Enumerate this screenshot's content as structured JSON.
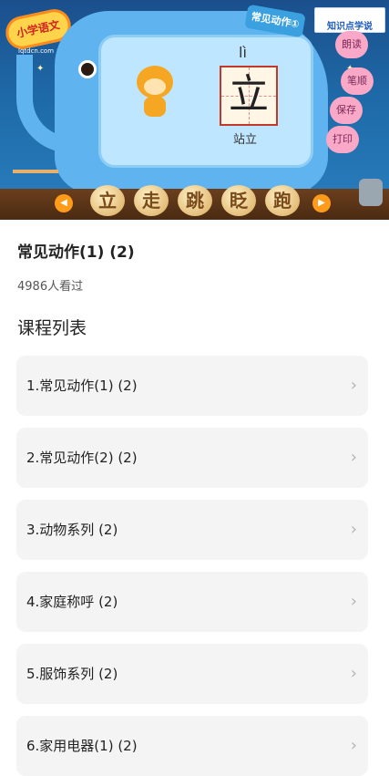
{
  "banner": {
    "logo_text": "小学语文",
    "logo_url": "lqtdcn.com",
    "title_tag": "常见动作①",
    "site_name": "知识点学说",
    "pinyin": "lì",
    "character": "立",
    "word": "站立",
    "side_buttons": [
      "朗读",
      "笔顺",
      "保存",
      "打印"
    ],
    "nav_chars": [
      "立",
      "走",
      "跳",
      "眨",
      "跑"
    ],
    "prev_icon": "left-arrow-icon",
    "next_icon": "right-arrow-icon"
  },
  "course": {
    "title": "常见动作(1) (2)",
    "views": "4986人看过"
  },
  "section_title": "课程列表",
  "lessons": [
    {
      "label": "1.常见动作(1) (2)"
    },
    {
      "label": "2.常见动作(2) (2)"
    },
    {
      "label": "3.动物系列 (2)"
    },
    {
      "label": "4.家庭称呼 (2)"
    },
    {
      "label": "5.服饰系列 (2)"
    },
    {
      "label": "6.家用电器(1) (2)"
    }
  ],
  "chevron_icon": "chevron-right-icon",
  "colors": {
    "banner_sky": "#1e6aa8",
    "elephant": "#5fb4f0",
    "list_bg": "#f4f4f4",
    "chevron": "#b3b3b3"
  }
}
